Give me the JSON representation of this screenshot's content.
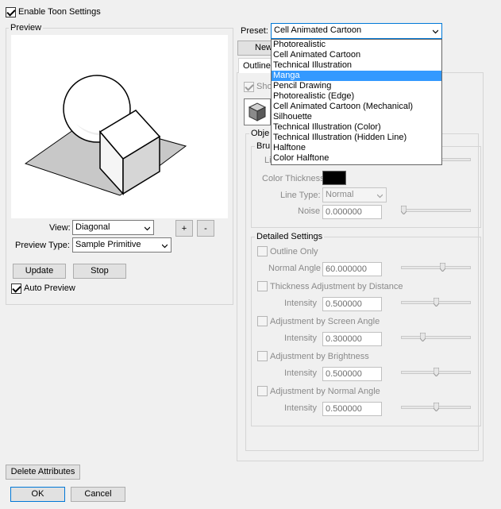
{
  "enable_toon": {
    "label": "Enable Toon Settings",
    "checked": true
  },
  "preview": {
    "group_label": "Preview",
    "view_label": "View:",
    "view_value": "Diagonal",
    "preview_type_label": "Preview Type:",
    "preview_type_value": "Sample Primitive",
    "plus_label": "+",
    "minus_label": "-",
    "update_label": "Update",
    "stop_label": "Stop",
    "auto_preview_label": "Auto Preview",
    "auto_preview_checked": true
  },
  "preset": {
    "label": "Preset:",
    "selected": "Cell Animated Cartoon",
    "options": [
      "Photorealistic",
      "Cell Animated Cartoon",
      "Technical Illustration",
      "Manga",
      "Pencil Drawing",
      "Photorealistic (Edge)",
      "Cell Animated Cartoon (Mechanical)",
      "Silhouette",
      "Technical Illustration (Color)",
      "Technical Illustration (Hidden Line)",
      "Halftone",
      "Color Halftone"
    ],
    "highlighted": "Manga",
    "new_button_partial": "New",
    "outline_tab_partial": "Outline",
    "show_partial": "Sho",
    "object_partial": "Obje",
    "brush_partial": "Bru",
    "line_partial": "Li"
  },
  "brush": {
    "color_thickness_label": "Color Thickness",
    "color_thickness_value": "#000000",
    "line_type_label": "Line Type:",
    "line_type_value": "Normal",
    "noise_label": "Noise",
    "noise_value": "0.000000",
    "noise_slider": 0.0
  },
  "detailed": {
    "group_label": "Detailed Settings",
    "outline_only_label": "Outline Only",
    "normal_angle_label": "Normal Angle",
    "normal_angle_value": "60.000000",
    "normal_angle_slider": 0.6,
    "thickness_distance_label": "Thickness Adjustment by Distance",
    "intensity_label": "Intensity",
    "thickness_intensity_value": "0.500000",
    "thickness_intensity_slider": 0.5,
    "screen_angle_label": "Adjustment by Screen Angle",
    "screen_angle_intensity_value": "0.300000",
    "screen_angle_slider": 0.3,
    "brightness_label": "Adjustment by Brightness",
    "brightness_intensity_value": "0.500000",
    "brightness_slider": 0.5,
    "normal_angle_adj_label": "Adjustment by Normal Angle",
    "normal_angle_adj_intensity_value": "0.500000",
    "normal_angle_adj_slider": 0.5
  },
  "footer": {
    "delete_label": "Delete Attributes",
    "ok_label": "OK",
    "cancel_label": "Cancel"
  }
}
